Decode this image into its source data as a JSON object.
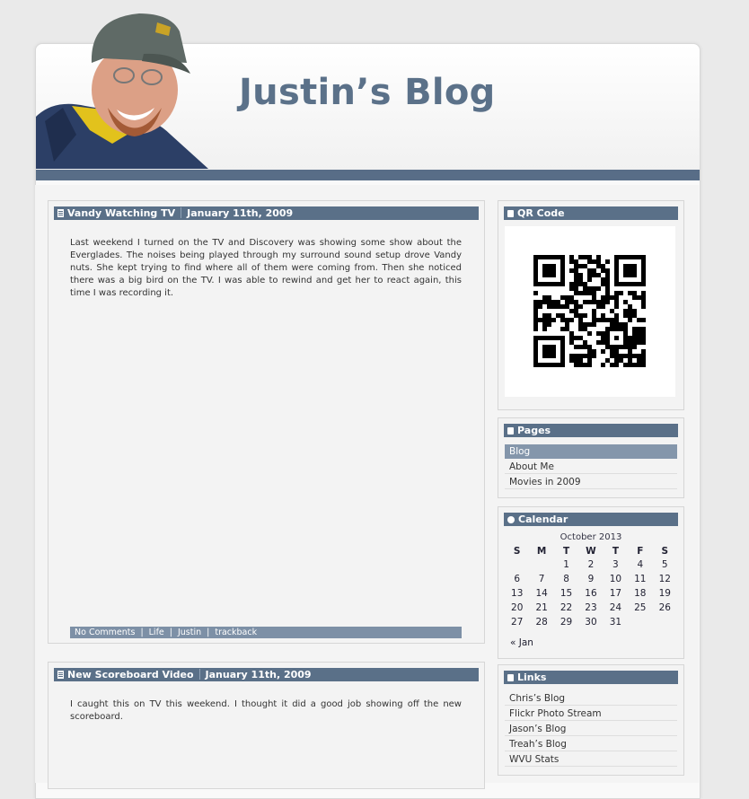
{
  "blog": {
    "title": "Justin’s Blog"
  },
  "posts": [
    {
      "title": "Vandy Watching TV",
      "date": "January 11th, 2009",
      "body": "Last weekend I turned on the TV and Discovery was showing some show about the Everglades. The noises being played through my surround sound setup drove Vandy nuts. She kept trying to find where all of them were coming from. Then she noticed there was a big bird on the TV. I was able to rewind and get her to react again, this time I was recording it.",
      "footer": {
        "comments": "No Comments",
        "category": "Life",
        "author": "Justin",
        "trackback": "trackback",
        "separator": "|"
      }
    },
    {
      "title": "New Scoreboard Video",
      "date": "January 11th, 2009",
      "body": "I caught this on TV this weekend. I thought it did a good job showing off the new scoreboard."
    }
  ],
  "sidebar": {
    "qr": {
      "title": "QR Code"
    },
    "pages": {
      "title": "Pages",
      "items": [
        "Blog",
        "About Me",
        "Movies in 2009"
      ]
    },
    "calendar": {
      "title": "Calendar",
      "month": "October 2013",
      "weekdays": [
        "S",
        "M",
        "T",
        "W",
        "T",
        "F",
        "S"
      ],
      "weeks": [
        [
          "",
          "",
          "1",
          "2",
          "3",
          "4",
          "5"
        ],
        [
          "6",
          "7",
          "8",
          "9",
          "10",
          "11",
          "12"
        ],
        [
          "13",
          "14",
          "15",
          "16",
          "17",
          "18",
          "19"
        ],
        [
          "20",
          "21",
          "22",
          "23",
          "24",
          "25",
          "26"
        ],
        [
          "27",
          "28",
          "29",
          "30",
          "31",
          "",
          ""
        ]
      ],
      "prev": "« Jan"
    },
    "links": {
      "title": "Links",
      "items": [
        "Chris’s Blog",
        "Flickr Photo Stream",
        "Jason’s Blog",
        "Treah’s Blog",
        "WVU Stats"
      ]
    }
  },
  "colors": {
    "accent": "#5a7088",
    "title": "#5b7189",
    "active": "#8496ab"
  }
}
